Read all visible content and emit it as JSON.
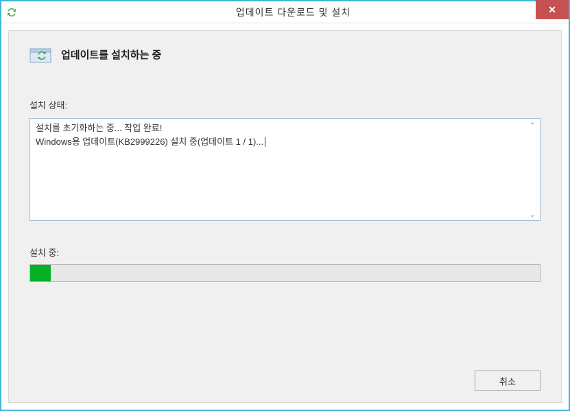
{
  "window": {
    "title": "업데이트 다운로드 및 설치"
  },
  "header": {
    "text": "업데이트를 설치하는 중"
  },
  "status": {
    "label": "설치 상태:",
    "line1": "설치를 초기화하는 중... 작업 완료!",
    "line2": "Windows용 업데이트(KB2999226) 설치 중(업데이트 1 / 1)..."
  },
  "progress": {
    "label": "설치 중:",
    "percent": 4
  },
  "buttons": {
    "cancel": "취소"
  }
}
